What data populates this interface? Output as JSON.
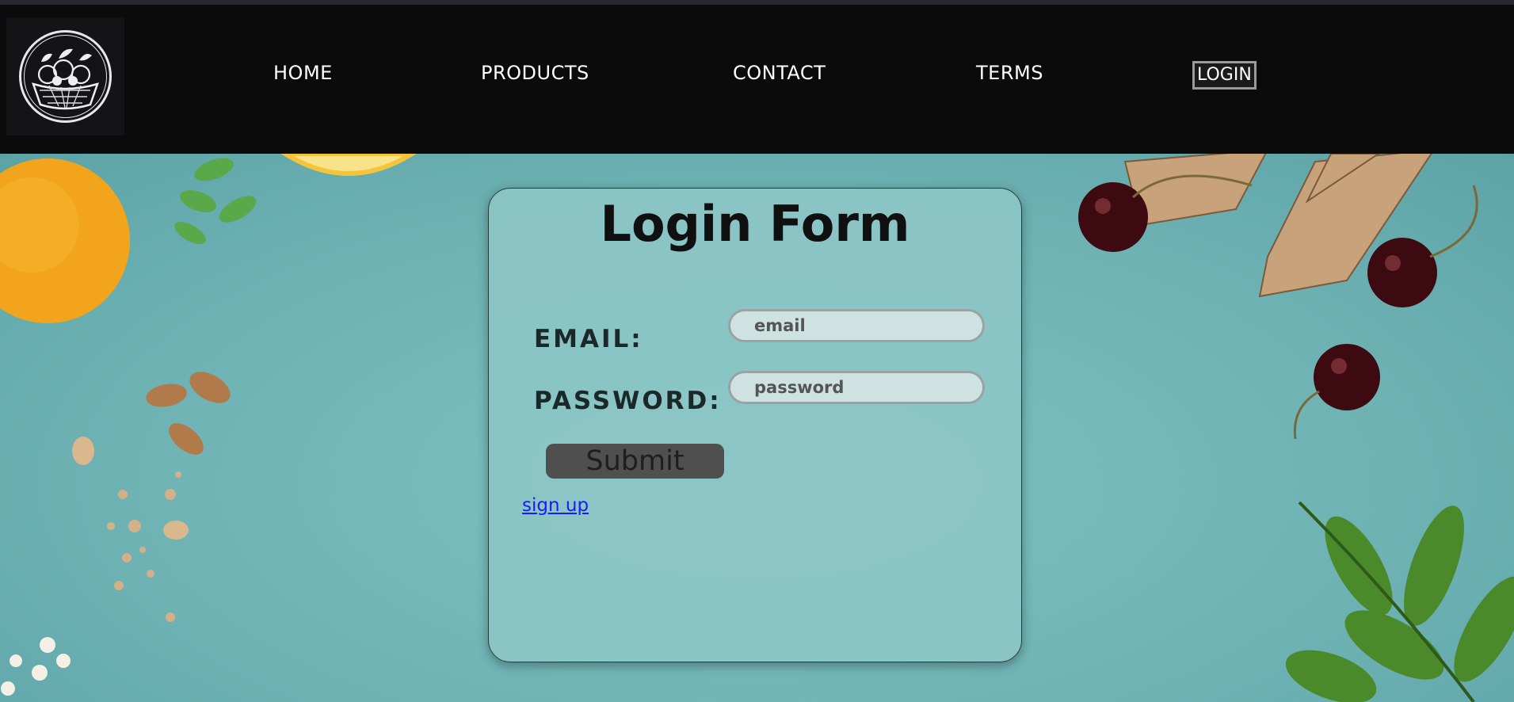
{
  "nav": {
    "logo": "fruit-basket-logo",
    "items": [
      {
        "label": "HOME"
      },
      {
        "label": "PRODUCTS"
      },
      {
        "label": "CONTACT"
      },
      {
        "label": "TERMS"
      },
      {
        "label": "LOGIN"
      }
    ]
  },
  "form": {
    "title": "Login Form",
    "email_label": "EMAIL:",
    "email_placeholder": "email",
    "password_label": "PASSWORD:",
    "password_placeholder": "password",
    "submit_label": "Submit",
    "signup_label": "sign up"
  },
  "colors": {
    "navbar": "#0b0b0c",
    "background": "#6fb5b5",
    "card": "#8cc6c6",
    "submit": "#4f4f4f",
    "link": "#1a1aff"
  }
}
